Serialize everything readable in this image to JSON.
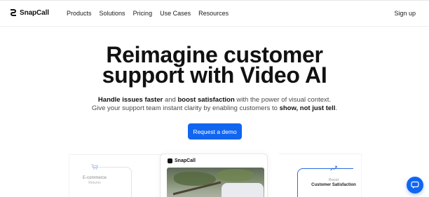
{
  "header": {
    "brand": "SnapCall",
    "nav": [
      "Products",
      "Solutions",
      "Pricing",
      "Use Cases",
      "Resources"
    ],
    "signup_label": "Sign up"
  },
  "hero": {
    "headline_line1": "Reimagine customer",
    "headline_line2": "support with Video AI",
    "sub1_a": "Handle issues faster",
    "sub1_b": " and ",
    "sub1_c": "boost satisfaction",
    "sub1_d": " with the power of visual context.",
    "sub2_a": "Give your support team instant clarity by enabling customers to ",
    "sub2_b": "show, not just tell",
    "sub2_c": ".",
    "cta_label": "Request a demo"
  },
  "preview": {
    "left_label": "E-commerce",
    "left_sub": "Returns",
    "card_brand": "SnapCall",
    "right_label": "Boost",
    "right_sub": "Customer Satisfaction"
  },
  "colors": {
    "accent": "#1166f0",
    "text": "#111111",
    "muted": "#4a4a4a"
  },
  "icons": {
    "logo": "snapcall-logo-icon",
    "cart": "cart-icon",
    "trend": "trend-up-icon",
    "chat": "chat-icon"
  }
}
